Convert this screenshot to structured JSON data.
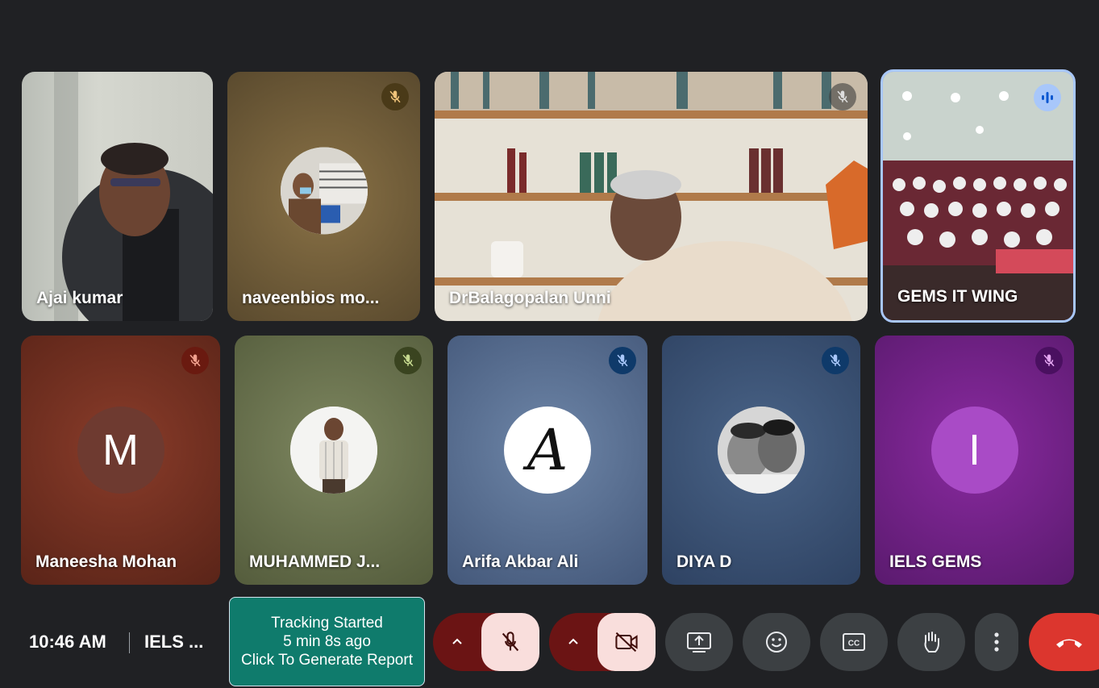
{
  "tiles": [
    {
      "name": "Ajai kumar"
    },
    {
      "name": "naveenbios mo..."
    },
    {
      "name": "DrBalagopalan Unni"
    },
    {
      "name": "GEMS IT WING"
    },
    {
      "name": "Maneesha Mohan",
      "initial": "M"
    },
    {
      "name": "MUHAMMED J..."
    },
    {
      "name": "Arifa Akbar Ali",
      "initial": "A"
    },
    {
      "name": "DIYA D"
    },
    {
      "name": "IELS GEMS",
      "initial": "I"
    }
  ],
  "bar": {
    "time": "10:46 AM",
    "meeting_name": "IELS ...",
    "tracking_line1": "Tracking Started",
    "tracking_line2": "5 min 8s ago",
    "tracking_line3": "Click To Generate Report"
  },
  "icons": {
    "mic_off": "mic-off-icon",
    "camera_off": "camera-off-icon",
    "present": "present-screen-icon",
    "emoji": "emoji-icon",
    "captions": "captions-icon",
    "hand": "raise-hand-icon",
    "more": "more-options-icon",
    "leave": "leave-call-icon"
  },
  "colors": {
    "background": "#202124",
    "leave": "#dc362e",
    "muted_button": "#f9dedc",
    "tracking": "#0f7b6c",
    "speaking_border": "#a8c7fa"
  }
}
